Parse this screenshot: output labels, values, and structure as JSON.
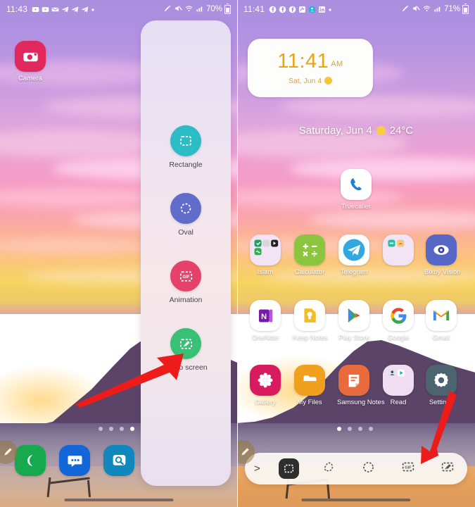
{
  "left_phone": {
    "status_bar": {
      "time": "11:43",
      "battery_text": "70%",
      "notification_icons": [
        "video-icon",
        "video-icon",
        "envelope-icon",
        "telegram-icon",
        "telegram-icon",
        "telegram-icon",
        "dot-icon"
      ],
      "right_icons": [
        "dnd-slash-icon",
        "mute-icon",
        "wifi-icon",
        "signal-icon"
      ]
    },
    "home": {
      "camera_app": {
        "label": "Camera",
        "color": "#e0275e"
      },
      "dock": [
        {
          "name": "phone-app",
          "label": "",
          "color": "#17a94d"
        },
        {
          "name": "messages-app",
          "label": "",
          "color": "#1266d8"
        },
        {
          "name": "internet-app",
          "label": "",
          "color": "#1088bd"
        }
      ],
      "page_dots": {
        "count": 4,
        "active": 4
      }
    },
    "air_command_panel": {
      "items": [
        {
          "label": "Rectangle",
          "icon": "rectangle-select-icon",
          "color": "#2bbcc6"
        },
        {
          "label": "Oval",
          "icon": "oval-select-icon",
          "color": "#5f6cc9"
        },
        {
          "label": "Animation",
          "icon": "gif-select-icon",
          "color": "#e5416b"
        },
        {
          "label": "Pin to screen",
          "icon": "pin-to-screen-icon",
          "color": "#37c076"
        }
      ]
    }
  },
  "right_phone": {
    "status_bar": {
      "time": "11:41",
      "battery_text": "71%",
      "notification_icons": [
        "facebook-icon",
        "facebook-icon",
        "facebook-icon",
        "messenger-icon",
        "teams-icon",
        "linkedin-icon",
        "dot-icon"
      ],
      "right_icons": [
        "dnd-slash-icon",
        "mute-icon",
        "wifi-icon",
        "signal-icon"
      ]
    },
    "clock_widget": {
      "time": "11:41",
      "ampm": "AM",
      "date": "Sat, Jun 4",
      "weather_icon": "sun-icon"
    },
    "date_weather": {
      "date": "Saturday, Jun 4",
      "weather_icon": "sun-icon",
      "temperature": "24°C"
    },
    "app_rows": [
      [
        {
          "label": "Truecaller",
          "icon": "truecaller-icon",
          "color": "#ffffff"
        }
      ],
      [
        {
          "label": "Islam",
          "icon": "folder-islam-icon",
          "color": "#f2e3f5"
        },
        {
          "label": "Calculator",
          "icon": "calculator-icon",
          "color": "#8cc63f"
        },
        {
          "label": "Telegram",
          "icon": "telegram-icon",
          "color": "#ffffff"
        },
        {
          "label": "",
          "icon": "folder-unnamed-icon",
          "color": "#f2e3f5"
        },
        {
          "label": "Bixby Vision",
          "icon": "bixby-vision-icon",
          "color": "#5767c4"
        }
      ],
      [
        {
          "label": "OneNote",
          "icon": "onenote-icon",
          "color": "#ffffff"
        },
        {
          "label": "Keep Notes",
          "icon": "keep-notes-icon",
          "color": "#ffffff"
        },
        {
          "label": "Play Store",
          "icon": "play-store-icon",
          "color": "#ffffff"
        },
        {
          "label": "Google",
          "icon": "google-icon",
          "color": "#ffffff"
        },
        {
          "label": "Gmail",
          "icon": "gmail-icon",
          "color": "#ffffff"
        }
      ],
      [
        {
          "label": "Gallery",
          "icon": "gallery-icon",
          "color": "#d81b5f"
        },
        {
          "label": "My Files",
          "icon": "my-files-icon",
          "color": "#f0a01e"
        },
        {
          "label": "Samsung Notes",
          "icon": "samsung-notes-icon",
          "color": "#e96a3c"
        },
        {
          "label": "Read",
          "icon": "folder-read-icon",
          "color": "#f0ddf2"
        },
        {
          "label": "Settings",
          "icon": "settings-icon",
          "color": "#4b6470"
        }
      ]
    ],
    "page_dots": {
      "count": 4,
      "active": 1
    },
    "toolbar": {
      "expand_label": ">",
      "items": [
        {
          "name": "rectangle-select-tool",
          "selected": true
        },
        {
          "name": "freeform-select-tool",
          "selected": false
        },
        {
          "name": "oval-select-tool",
          "selected": false
        },
        {
          "name": "gif-animation-tool",
          "selected": false
        },
        {
          "name": "pin-to-screen-tool",
          "selected": false
        }
      ]
    }
  },
  "annotations": {
    "arrow_color": "#ee1b1b",
    "left_arrow_target": "Pin to screen",
    "right_arrow_target": "pin-to-screen-tool"
  }
}
